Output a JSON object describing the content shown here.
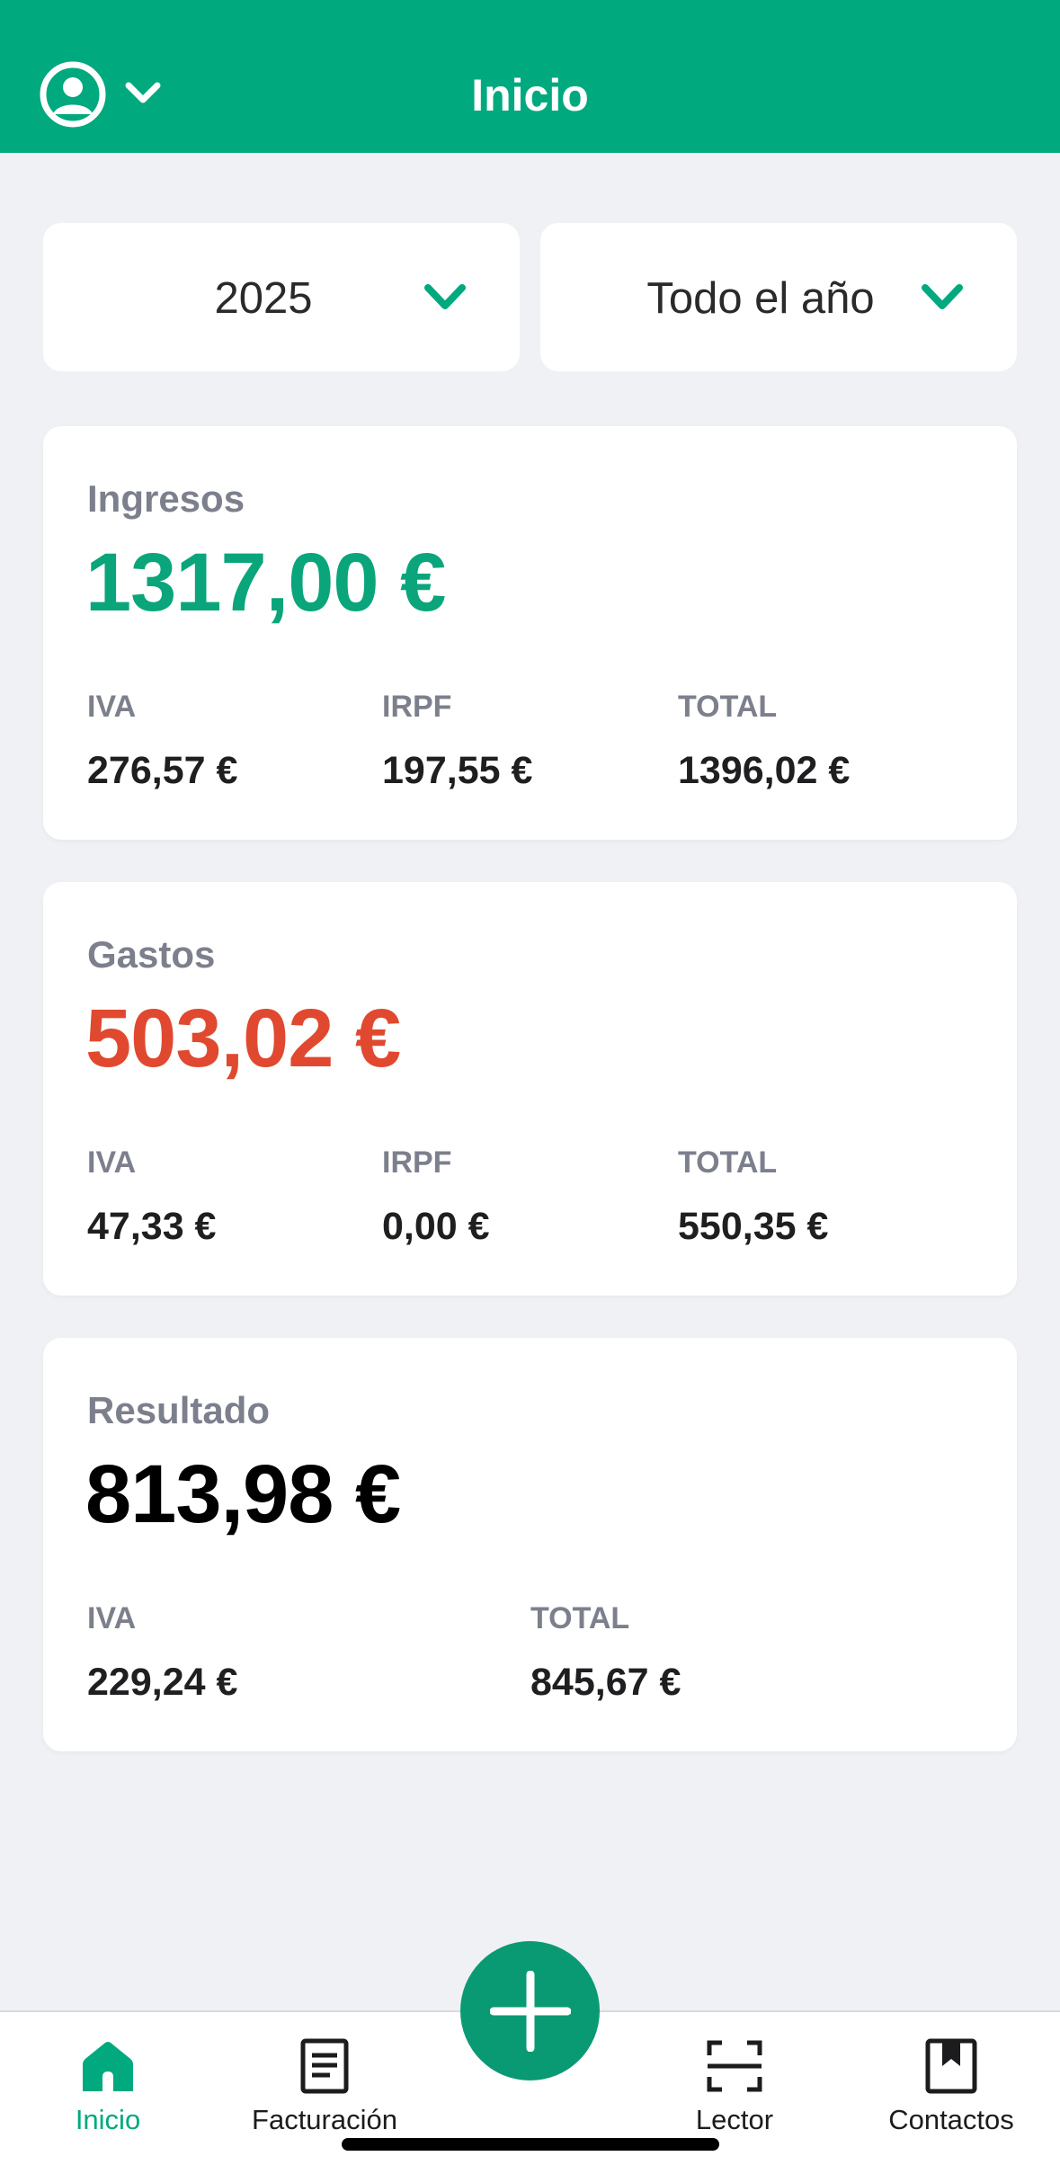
{
  "header": {
    "title": "Inicio"
  },
  "filters": {
    "year": "2025",
    "period": "Todo el año"
  },
  "income": {
    "label": "Ingresos",
    "amount": "1317,00 €",
    "iva_label": "IVA",
    "iva": "276,57 €",
    "irpf_label": "IRPF",
    "irpf": "197,55 €",
    "total_label": "TOTAL",
    "total": "1396,02 €"
  },
  "expenses": {
    "label": "Gastos",
    "amount": "503,02 €",
    "iva_label": "IVA",
    "iva": "47,33 €",
    "irpf_label": "IRPF",
    "irpf": "0,00 €",
    "total_label": "TOTAL",
    "total": "550,35 €"
  },
  "result": {
    "label": "Resultado",
    "amount": "813,98 €",
    "iva_label": "IVA",
    "iva": "229,24 €",
    "total_label": "TOTAL",
    "total": "845,67 €"
  },
  "tabs": [
    {
      "label": "Inicio",
      "icon": "home-icon"
    },
    {
      "label": "Facturación",
      "icon": "document-icon"
    },
    {
      "label": "Lector",
      "icon": "scan-icon"
    },
    {
      "label": "Contactos",
      "icon": "contacts-book-icon"
    }
  ],
  "fab": {
    "icon": "plus-icon"
  },
  "colors": {
    "brand": "#00a97e",
    "income": "#0aa57a",
    "expense": "#e0492f",
    "result": "#000000",
    "fab": "#0a9a73"
  }
}
